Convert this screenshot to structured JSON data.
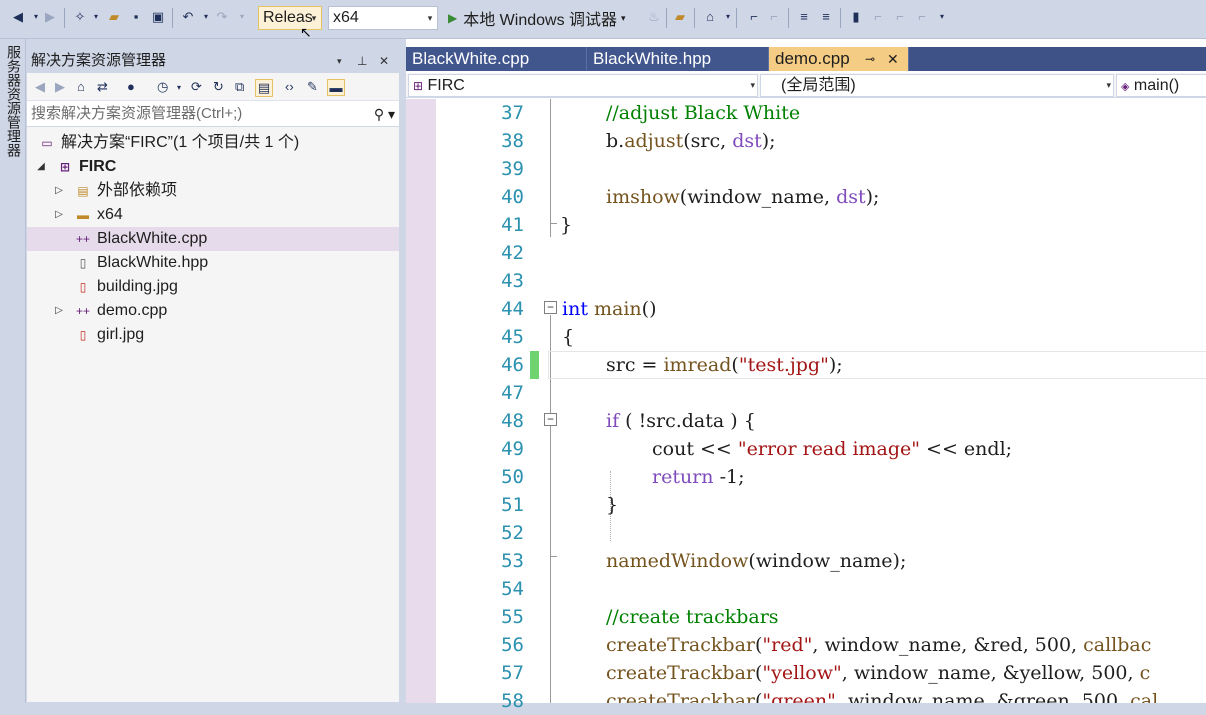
{
  "toolbar": {
    "config": "Releas",
    "platform": "x64",
    "debugger": "本地 Windows 调试器"
  },
  "side_strip": {
    "label": "服务器资源管理器"
  },
  "solution_explorer": {
    "title": "解决方案资源管理器",
    "search_placeholder": "搜索解决方案资源管理器(Ctrl+;)",
    "items": [
      {
        "label": "解决方案“FIRC”(1 个项目/共 1 个)",
        "icon": "solution-icon"
      },
      {
        "label": "FIRC",
        "icon": "project-icon"
      },
      {
        "label": "外部依赖项",
        "icon": "dependencies-icon"
      },
      {
        "label": "x64",
        "icon": "folder-icon"
      },
      {
        "label": "BlackWhite.cpp",
        "icon": "cpp-file-icon"
      },
      {
        "label": "BlackWhite.hpp",
        "icon": "header-file-icon"
      },
      {
        "label": "building.jpg",
        "icon": "image-file-icon"
      },
      {
        "label": "demo.cpp",
        "icon": "cpp-file-icon"
      },
      {
        "label": "girl.jpg",
        "icon": "image-file-icon"
      }
    ]
  },
  "editor": {
    "tabs": [
      "BlackWhite.cpp",
      "BlackWhite.hpp",
      "demo.cpp"
    ],
    "active_tab": "demo.cpp",
    "nav": {
      "project": "FIRC",
      "scope": "(全局范围)",
      "member": "main()"
    },
    "line_numbers": [
      "37",
      "38",
      "39",
      "40",
      "41",
      "42",
      "43",
      "44",
      "45",
      "46",
      "47",
      "48",
      "49",
      "50",
      "51",
      "52",
      "53",
      "54",
      "55",
      "56",
      "57",
      "58"
    ],
    "code": {
      "l37": "//adjust Black White",
      "l38a": "b.",
      "l38b": "adjust",
      "l38c": "(src, ",
      "l38d": "dst",
      "l38e": ");",
      "l40a": "imshow",
      "l40b": "(window_name, ",
      "l40c": "dst",
      "l40d": ");",
      "l41": "}",
      "l44a": "int",
      "l44b": " main",
      "l44c": "()",
      "l45": "{",
      "l46a": "src = ",
      "l46b": "imread",
      "l46c": "(",
      "l46d": "\"test.jpg\"",
      "l46e": ");",
      "l48a": "if",
      "l48b": " ( !src.data ) {",
      "l49a": "cout << ",
      "l49b": "\"error read image\"",
      "l49c": " << endl;",
      "l50a": "return",
      "l50b": " -1;",
      "l51": "}",
      "l53a": "namedWindow",
      "l53b": "(window_name);",
      "l55": "//create trackbars",
      "l56a": "createTrackbar",
      "l56b": "(",
      "l56c": "\"red\"",
      "l56d": ", window_name, &red, 500, ",
      "l56e": "callbac",
      "l57a": "createTrackbar",
      "l57b": "(",
      "l57c": "\"yellow\"",
      "l57d": ", window_name, &yellow, 500, ",
      "l57e": "c",
      "l58a": "createTrackbar",
      "l58b": "(",
      "l58c": "\"green\"",
      "l58d": ", window_name, &green, 500, ",
      "l58e": "cal"
    }
  }
}
